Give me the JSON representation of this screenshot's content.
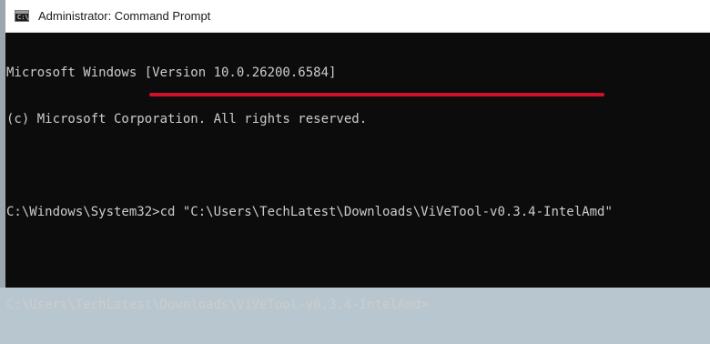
{
  "window": {
    "title": "Administrator: Command Prompt",
    "icon": "cmd-icon"
  },
  "console": {
    "lines": [
      "Microsoft Windows [Version 10.0.26200.6584]",
      "(c) Microsoft Corporation. All rights reserved.",
      "",
      "C:\\Windows\\System32>cd \"C:\\Users\\TechLatest\\Downloads\\ViVeTool-v0.3.4-IntelAmd\"",
      "",
      "C:\\Users\\TechLatest\\Downloads\\ViVeTool-v0.3.4-IntelAmd>"
    ]
  },
  "annotation": {
    "underline_color": "#d0112b"
  }
}
